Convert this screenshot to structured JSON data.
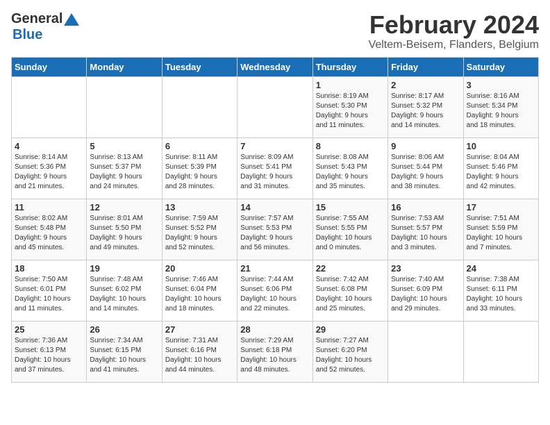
{
  "header": {
    "logo_line1": "General",
    "logo_line2": "Blue",
    "title": "February 2024",
    "subtitle": "Veltem-Beisem, Flanders, Belgium"
  },
  "weekdays": [
    "Sunday",
    "Monday",
    "Tuesday",
    "Wednesday",
    "Thursday",
    "Friday",
    "Saturday"
  ],
  "weeks": [
    [
      {
        "day": "",
        "info": ""
      },
      {
        "day": "",
        "info": ""
      },
      {
        "day": "",
        "info": ""
      },
      {
        "day": "",
        "info": ""
      },
      {
        "day": "1",
        "info": "Sunrise: 8:19 AM\nSunset: 5:30 PM\nDaylight: 9 hours\nand 11 minutes."
      },
      {
        "day": "2",
        "info": "Sunrise: 8:17 AM\nSunset: 5:32 PM\nDaylight: 9 hours\nand 14 minutes."
      },
      {
        "day": "3",
        "info": "Sunrise: 8:16 AM\nSunset: 5:34 PM\nDaylight: 9 hours\nand 18 minutes."
      }
    ],
    [
      {
        "day": "4",
        "info": "Sunrise: 8:14 AM\nSunset: 5:36 PM\nDaylight: 9 hours\nand 21 minutes."
      },
      {
        "day": "5",
        "info": "Sunrise: 8:13 AM\nSunset: 5:37 PM\nDaylight: 9 hours\nand 24 minutes."
      },
      {
        "day": "6",
        "info": "Sunrise: 8:11 AM\nSunset: 5:39 PM\nDaylight: 9 hours\nand 28 minutes."
      },
      {
        "day": "7",
        "info": "Sunrise: 8:09 AM\nSunset: 5:41 PM\nDaylight: 9 hours\nand 31 minutes."
      },
      {
        "day": "8",
        "info": "Sunrise: 8:08 AM\nSunset: 5:43 PM\nDaylight: 9 hours\nand 35 minutes."
      },
      {
        "day": "9",
        "info": "Sunrise: 8:06 AM\nSunset: 5:44 PM\nDaylight: 9 hours\nand 38 minutes."
      },
      {
        "day": "10",
        "info": "Sunrise: 8:04 AM\nSunset: 5:46 PM\nDaylight: 9 hours\nand 42 minutes."
      }
    ],
    [
      {
        "day": "11",
        "info": "Sunrise: 8:02 AM\nSunset: 5:48 PM\nDaylight: 9 hours\nand 45 minutes."
      },
      {
        "day": "12",
        "info": "Sunrise: 8:01 AM\nSunset: 5:50 PM\nDaylight: 9 hours\nand 49 minutes."
      },
      {
        "day": "13",
        "info": "Sunrise: 7:59 AM\nSunset: 5:52 PM\nDaylight: 9 hours\nand 52 minutes."
      },
      {
        "day": "14",
        "info": "Sunrise: 7:57 AM\nSunset: 5:53 PM\nDaylight: 9 hours\nand 56 minutes."
      },
      {
        "day": "15",
        "info": "Sunrise: 7:55 AM\nSunset: 5:55 PM\nDaylight: 10 hours\nand 0 minutes."
      },
      {
        "day": "16",
        "info": "Sunrise: 7:53 AM\nSunset: 5:57 PM\nDaylight: 10 hours\nand 3 minutes."
      },
      {
        "day": "17",
        "info": "Sunrise: 7:51 AM\nSunset: 5:59 PM\nDaylight: 10 hours\nand 7 minutes."
      }
    ],
    [
      {
        "day": "18",
        "info": "Sunrise: 7:50 AM\nSunset: 6:01 PM\nDaylight: 10 hours\nand 11 minutes."
      },
      {
        "day": "19",
        "info": "Sunrise: 7:48 AM\nSunset: 6:02 PM\nDaylight: 10 hours\nand 14 minutes."
      },
      {
        "day": "20",
        "info": "Sunrise: 7:46 AM\nSunset: 6:04 PM\nDaylight: 10 hours\nand 18 minutes."
      },
      {
        "day": "21",
        "info": "Sunrise: 7:44 AM\nSunset: 6:06 PM\nDaylight: 10 hours\nand 22 minutes."
      },
      {
        "day": "22",
        "info": "Sunrise: 7:42 AM\nSunset: 6:08 PM\nDaylight: 10 hours\nand 25 minutes."
      },
      {
        "day": "23",
        "info": "Sunrise: 7:40 AM\nSunset: 6:09 PM\nDaylight: 10 hours\nand 29 minutes."
      },
      {
        "day": "24",
        "info": "Sunrise: 7:38 AM\nSunset: 6:11 PM\nDaylight: 10 hours\nand 33 minutes."
      }
    ],
    [
      {
        "day": "25",
        "info": "Sunrise: 7:36 AM\nSunset: 6:13 PM\nDaylight: 10 hours\nand 37 minutes."
      },
      {
        "day": "26",
        "info": "Sunrise: 7:34 AM\nSunset: 6:15 PM\nDaylight: 10 hours\nand 41 minutes."
      },
      {
        "day": "27",
        "info": "Sunrise: 7:31 AM\nSunset: 6:16 PM\nDaylight: 10 hours\nand 44 minutes."
      },
      {
        "day": "28",
        "info": "Sunrise: 7:29 AM\nSunset: 6:18 PM\nDaylight: 10 hours\nand 48 minutes."
      },
      {
        "day": "29",
        "info": "Sunrise: 7:27 AM\nSunset: 6:20 PM\nDaylight: 10 hours\nand 52 minutes."
      },
      {
        "day": "",
        "info": ""
      },
      {
        "day": "",
        "info": ""
      }
    ]
  ]
}
